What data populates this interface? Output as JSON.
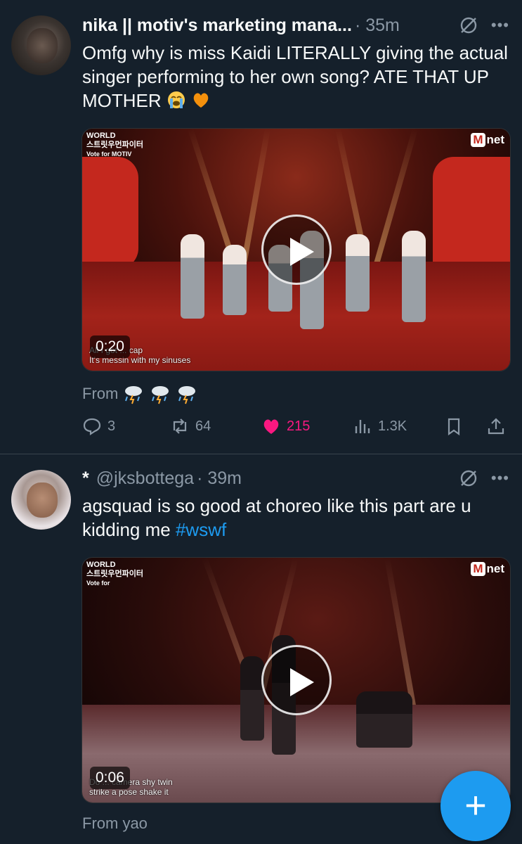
{
  "colors": {
    "background": "#15202b",
    "accent": "#1d9bf0",
    "like": "#f91880",
    "muted": "#8b98a5",
    "text": "#f7f9f9"
  },
  "tweets": [
    {
      "display_name": "nika || motiv's marketing mana...",
      "handle": "",
      "time": "· 35m",
      "text": "Omfg why is miss Kaidi LITERALLY giving the actual singer performing to her own song? ATE THAT UP MOTHER",
      "text_emojis": [
        "loudly-crying-face",
        "orange-heart"
      ],
      "media": {
        "duration": "0:20",
        "caption_line1": "All I got ... cap",
        "caption_line2": "It's messin with my sinuses",
        "logo_left_line1": "WORLD",
        "logo_left_line2": "스트릿우먼파이터",
        "logo_left_line3": "Vote for MOTIV",
        "logo_right": "net",
        "logo_right_mark": "M"
      },
      "from_label": "From",
      "from_emojis": [
        "cloud-with-lightning-and-rain",
        "cloud-with-lightning-and-rain",
        "cloud-with-lightning-and-rain"
      ],
      "stats": {
        "replies": "3",
        "retweets": "64",
        "likes": "215",
        "views": "1.3K"
      }
    },
    {
      "display_name": "*",
      "handle": "@jksbottega",
      "time": "· 39m",
      "text": "agsquad is so good at choreo like this part are u kidding me",
      "hashtag": "#wswf",
      "media": {
        "duration": "0:06",
        "caption_line1": "Do ... camera shy twin",
        "caption_line2": "strike a pose shake it",
        "logo_left_line1": "WORLD",
        "logo_left_line2": "스트릿우먼파이터",
        "logo_left_line3": "Vote for",
        "logo_right": "net",
        "logo_right_mark": "M"
      },
      "from_label": "From yao"
    }
  ],
  "fab": {
    "label": "+"
  }
}
